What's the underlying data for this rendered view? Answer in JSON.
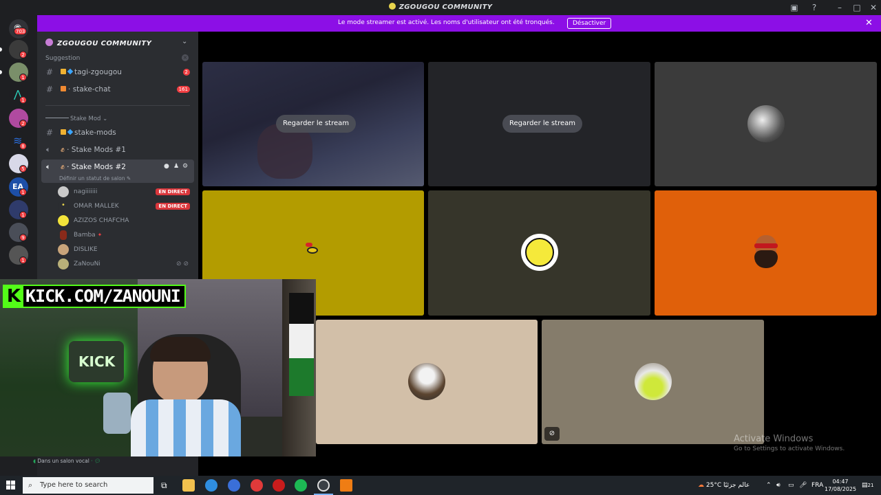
{
  "window": {
    "title": "ZGOUGOU COMMUNITY",
    "banner_text": "Le mode streamer est activé. Les noms d'utilisateur ont été tronqués.",
    "banner_button": "Désactiver",
    "close_glyph": "✕"
  },
  "rail": {
    "badges": [
      "703",
      "2",
      "1",
      "1",
      "2",
      "8",
      "5",
      "1",
      "1",
      "9",
      "1"
    ]
  },
  "sidebar": {
    "server_name": "ZGOUGOU COMMUNITY",
    "suggestion_label": "Suggestion",
    "channels_top": [
      {
        "name": "tagi-zgougou",
        "count": "2"
      },
      {
        "name": "stake-chat",
        "count": "161"
      }
    ],
    "category": "Stake Mod",
    "channels": [
      {
        "name": "stake-mods"
      },
      {
        "name": "Stake Mods #1"
      },
      {
        "name": "Stake Mods #2",
        "status": "Définir un statut de salon"
      }
    ],
    "members": [
      {
        "name": "nagiiiiiii",
        "live": "EN DIRECT"
      },
      {
        "name": "OMAR MALLEK",
        "live": "EN DIRECT"
      },
      {
        "name": "AZIZOS CHAFCHA"
      },
      {
        "name": "Bamba"
      },
      {
        "name": "DISLIKE"
      },
      {
        "name": "ZaNouNi"
      }
    ],
    "voice_status": "Dans un salon vocal"
  },
  "stage": {
    "watch_label_1": "Regarder le stream",
    "watch_label_2": "Regarder le stream",
    "colors": {
      "tile_yellow": "#b39c00",
      "tile_olive": "#36352a",
      "tile_orange": "#e0600a",
      "tile_beige": "#d2bfa8",
      "tile_tan": "#857c6b"
    }
  },
  "overlay": {
    "kick_logo": "K",
    "kick_text": "KICK.COM/ZANOUNI",
    "sign_text": "KICK"
  },
  "watermark": {
    "line1": "Activate Windows",
    "line2": "Go to Settings to activate Windows."
  },
  "taskbar": {
    "search_placeholder": "Type here to search",
    "weather": "25°C",
    "weather_desc": "عالم جزئيًا",
    "lang": "FRA",
    "time": "04:47",
    "date": "17/08/2025",
    "notif": "21"
  }
}
